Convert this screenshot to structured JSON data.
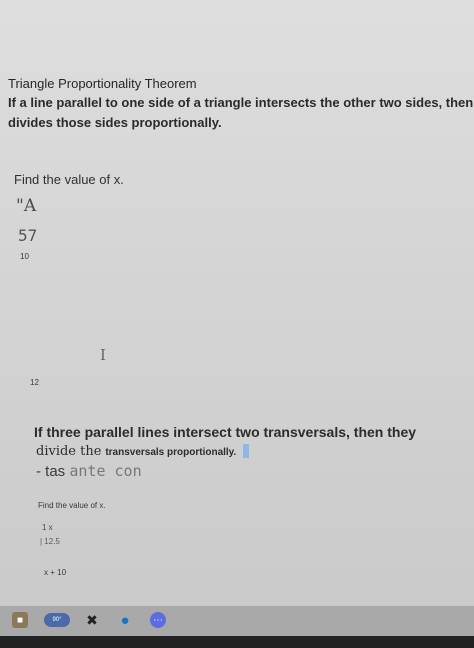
{
  "theorem": {
    "title": "Triangle Proportionality Theorem",
    "body": "If a line parallel to one side of a triangle intersects the other two sides, then it divides those sides proportionally."
  },
  "question1": {
    "prompt": "Find the value of x.",
    "label_a": "\"A",
    "label_57": "57",
    "label_10": "10",
    "cursor_glyph": "I",
    "label_12": "12"
  },
  "theorem2": {
    "line1": "If three parallel lines intersect two transversals, then they",
    "line2_lead": "divide the",
    "line2_small": "transversals proportionally.",
    "line3_lead": "- tas",
    "line3_mono": "ante con"
  },
  "question2": {
    "prompt": "Find the value of x.",
    "value_1x": "1 x",
    "value_125": "| 12.5",
    "value_x10": "x + 10"
  },
  "taskbar": {
    "weather_text": "90°",
    "icons": [
      "lock-icon",
      "weather-icon",
      "xbox-icon",
      "edge-icon",
      "chat-icon"
    ]
  }
}
